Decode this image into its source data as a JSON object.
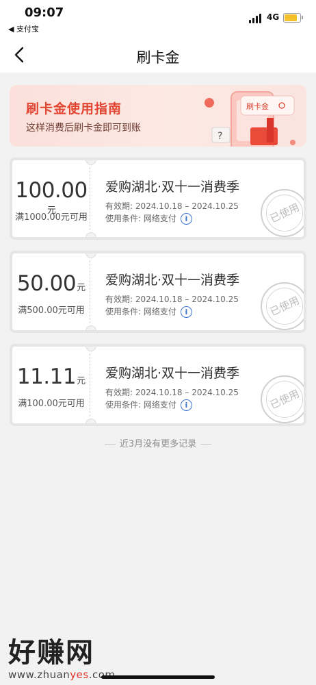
{
  "status_bar": {
    "time": "09:07",
    "back_app": "◀ 支付宝",
    "network": "4G"
  },
  "nav": {
    "title": "刷卡金"
  },
  "banner": {
    "title": "刷卡金使用指南",
    "subtitle": "这样消费后刷卡金即可到账",
    "art_label": "刷卡金"
  },
  "coupons": [
    {
      "amount": "100.00",
      "unit": "元",
      "threshold": "满1000.00元可用",
      "title": "爱购湖北·双十一消费季",
      "validity": "有效期: 2024.10.18 – 2024.10.25",
      "condition": "使用条件: 网络支付",
      "stamp": "已使用"
    },
    {
      "amount": "50.00",
      "unit": "元",
      "threshold": "满500.00元可用",
      "title": "爱购湖北·双十一消费季",
      "validity": "有效期: 2024.10.18 – 2024.10.25",
      "condition": "使用条件: 网络支付",
      "stamp": "已使用"
    },
    {
      "amount": "11.11",
      "unit": "元",
      "threshold": "满100.00元可用",
      "title": "爱购湖北·双十一消费季",
      "validity": "有效期: 2024.10.18 – 2024.10.25",
      "condition": "使用条件: 网络支付",
      "stamp": "已使用"
    }
  ],
  "footer_note": "近3月没有更多记录",
  "watermark": {
    "title": "好赚网",
    "url_prefix": "www.zhuan",
    "url_highlight": "yes",
    "url_suffix": ".com"
  },
  "colors": {
    "accent": "#e24632",
    "info_blue": "#3d74d7",
    "battery": "#f5c12b"
  },
  "icons": {
    "back": "chevron-left-icon",
    "info": "info-icon",
    "signal": "signal-icon",
    "battery": "battery-icon"
  }
}
